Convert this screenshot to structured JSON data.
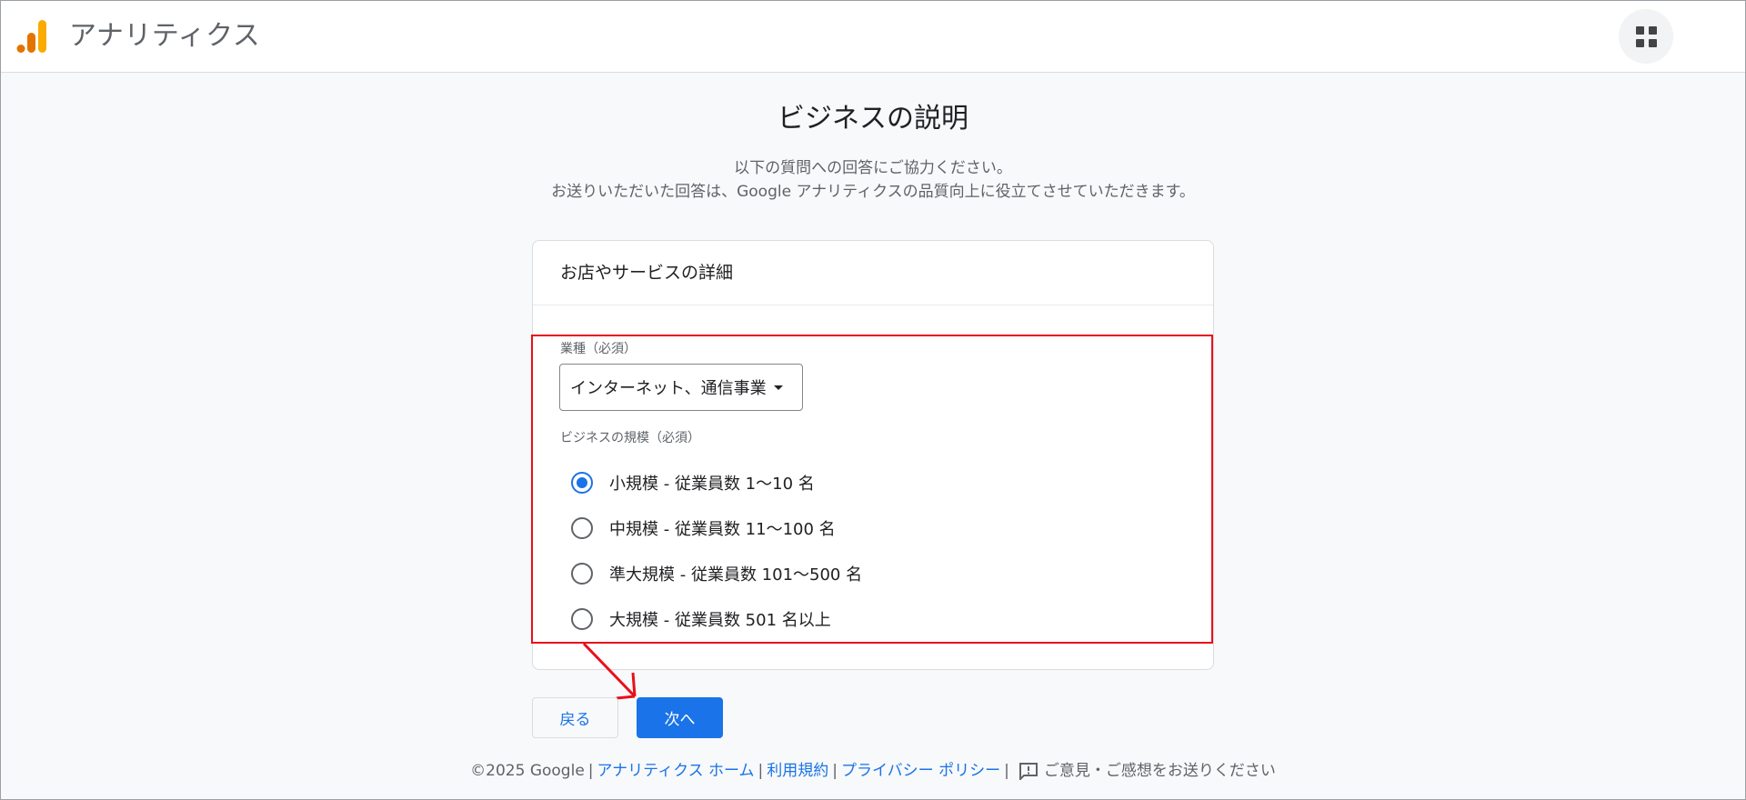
{
  "header": {
    "app_title": "アナリティクス",
    "apps_icon": "apps-grid-icon"
  },
  "page": {
    "title": "ビジネスの説明",
    "subtitle_line1": "以下の質問への回答にご協力ください。",
    "subtitle_line2": "お送りいただいた回答は、Google アナリティクスの品質向上に役立てさせていただきます。"
  },
  "card": {
    "title": "お店やサービスの詳細",
    "industry_label": "業種（必須）",
    "industry_value": "インターネット、通信事業",
    "size_label": "ビジネスの規模（必須）",
    "size_options": [
      {
        "label": "小規模 - 従業員数 1〜10 名",
        "checked": true
      },
      {
        "label": "中規模 - 従業員数 11〜100 名",
        "checked": false
      },
      {
        "label": "準大規模 - 従業員数 101〜500 名",
        "checked": false
      },
      {
        "label": "大規模 - 従業員数 501 名以上",
        "checked": false
      }
    ]
  },
  "buttons": {
    "back": "戻る",
    "next": "次へ"
  },
  "footer": {
    "copyright": "©2025 Google",
    "link_home": "アナリティクス ホーム",
    "link_terms": "利用規約",
    "link_privacy": "プライバシー ポリシー",
    "feedback": "ご意見・ご感想をお送りください"
  },
  "colors": {
    "accent": "#1a73e8",
    "highlight": "#e8101b",
    "logo_orange": "#f9ab00",
    "logo_dark_orange": "#e37400"
  }
}
